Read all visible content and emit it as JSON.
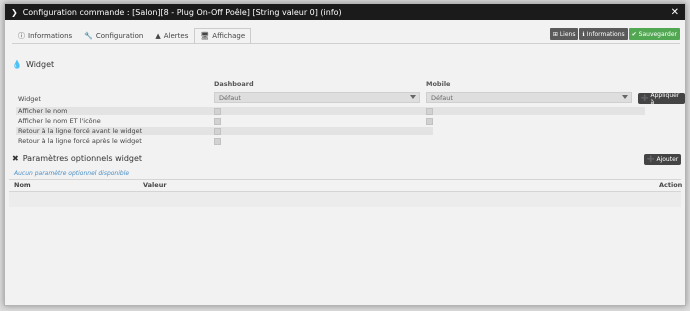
{
  "dialog": {
    "title": "Configuration commande : [Salon][8 - Plug On-Off Poêle] [String valeur 0] (info)",
    "close_glyph": "✕"
  },
  "tabs": [
    {
      "icon": "info-circle-icon",
      "glyph": "ⓘ",
      "label": "Informations"
    },
    {
      "icon": "wrench-icon",
      "glyph": "🔧",
      "label": "Configuration"
    },
    {
      "icon": "triangle-alert-icon",
      "glyph": "▲",
      "label": "Alertes"
    },
    {
      "icon": "monitor-icon",
      "glyph": "🖥",
      "label": "Affichage"
    }
  ],
  "active_tab": "Affichage",
  "actions": {
    "links": {
      "glyph": "⊞",
      "label": "Liens"
    },
    "informations": {
      "glyph": "ℹ",
      "label": "Informations"
    },
    "save": {
      "glyph": "✔",
      "label": "Sauvegarder"
    }
  },
  "widget_section": {
    "icon_glyph": "💧",
    "title": "Widget",
    "col_dashboard": "Dashboard",
    "col_mobile": "Mobile",
    "widget_label": "Widget",
    "dashboard_select": "Défaut",
    "mobile_select": "Défaut",
    "apply_button": {
      "glyph": "➕",
      "label": "Appliquer à"
    },
    "options": [
      {
        "label": "Afficher le nom",
        "dashboard_checked": false,
        "mobile_checked": false
      },
      {
        "label": "Afficher le nom ET l'icône",
        "dashboard_checked": false,
        "mobile_checked": false
      },
      {
        "label": "Retour à la ligne forcé avant le widget",
        "dashboard_checked": false
      },
      {
        "label": "Retour à la ligne forcé après le widget",
        "dashboard_checked": false
      }
    ]
  },
  "params_section": {
    "icon_glyph": "✖",
    "title": "Paramètres optionnels widget",
    "add_button": {
      "glyph": "➕",
      "label": "Ajouter"
    },
    "empty_text": "Aucun paramètre optionnel disponible",
    "columns": {
      "name": "Nom",
      "value": "Valeur",
      "action": "Action"
    }
  },
  "colors": {
    "titlebar": "#1b1b1b",
    "save_button": "#52a852",
    "dark_button": "#5a5a5a",
    "info_text": "#4a90c8"
  }
}
